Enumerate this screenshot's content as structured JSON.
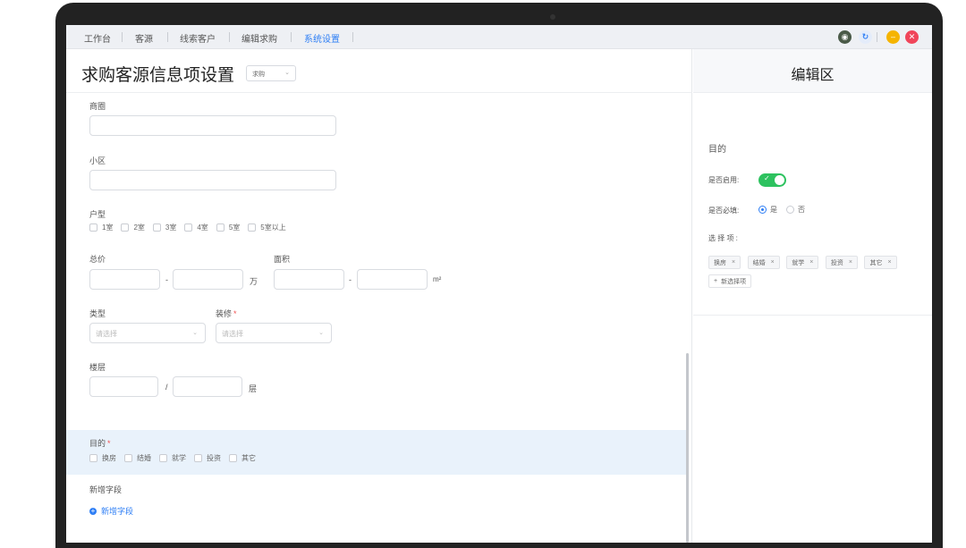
{
  "nav": {
    "tabs": [
      {
        "label": "工作台"
      },
      {
        "label": "客源"
      },
      {
        "label": "线索客户"
      },
      {
        "label": "编辑求购"
      },
      {
        "label": "系统设置"
      }
    ],
    "active_index": 4,
    "accent_color": "#2f7ff5"
  },
  "window_controls": [
    "avatar-icon",
    "refresh-icon",
    "minimize-icon",
    "close-icon"
  ],
  "left": {
    "title": "求购客源信息项设置",
    "type_select": "求购",
    "fields": {
      "shangquan": {
        "label": "商圈"
      },
      "xiaoqu": {
        "label": "小区"
      },
      "huxing": {
        "label": "户型",
        "options": [
          "1室",
          "2室",
          "3室",
          "4室",
          "5室",
          "5室以上"
        ]
      },
      "zongjia": {
        "label": "总价",
        "sep": "-",
        "unit": "万"
      },
      "mianji": {
        "label": "面积",
        "sep": "-",
        "unit": "m²"
      },
      "leixing": {
        "label": "类型",
        "placeholder": "请选择"
      },
      "zhuangxiu": {
        "label": "装修",
        "required": "*",
        "placeholder": "请选择"
      },
      "louceng": {
        "label": "楼层",
        "sep": "/",
        "unit": "层"
      },
      "mudi": {
        "label": "目的",
        "required": "*",
        "options": [
          "换房",
          "结婚",
          "就学",
          "投资",
          "其它"
        ]
      }
    },
    "new_field_section": "新增字段",
    "add_field_label": "新增字段"
  },
  "right": {
    "title": "编辑区",
    "field_name": "目的",
    "enabled_label": "是否启用:",
    "enabled": true,
    "required_label": "是否必填:",
    "required_options": [
      "是",
      "否"
    ],
    "required_selected": "是",
    "choices_label": "选 择 项 :",
    "choices": [
      "换房",
      "结婚",
      "就学",
      "投资",
      "其它"
    ],
    "add_choice_label": "新选择项"
  }
}
